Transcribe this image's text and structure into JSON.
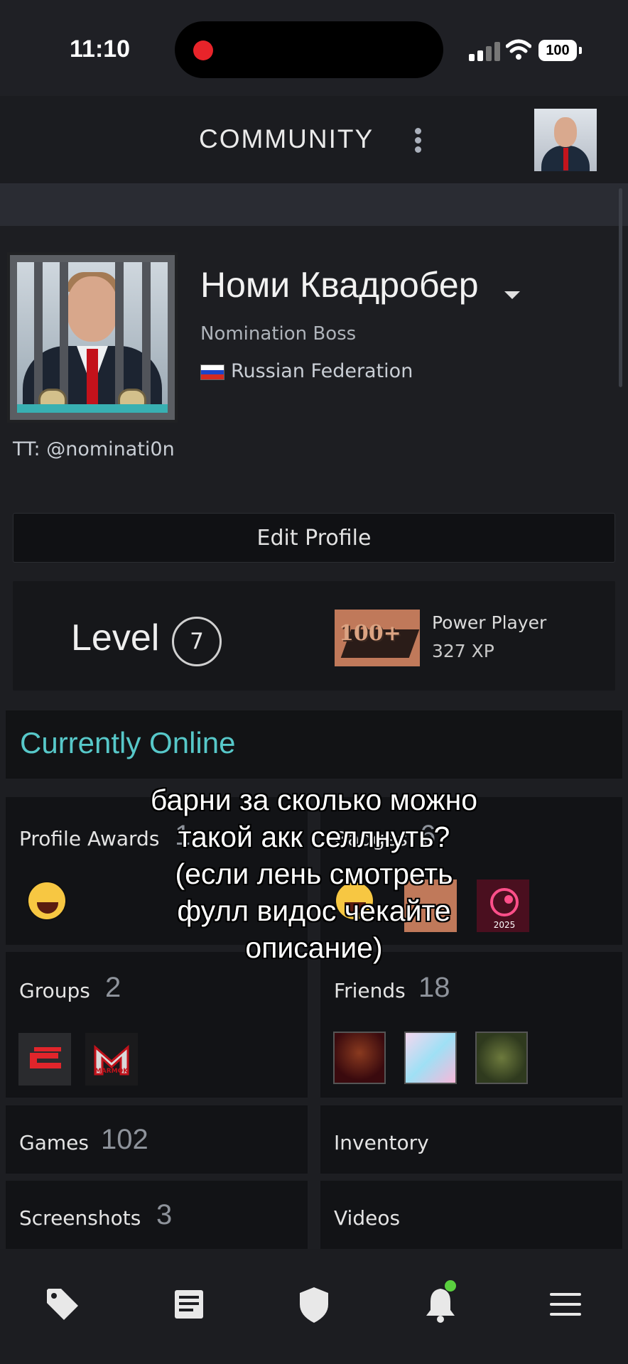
{
  "status_bar": {
    "time": "11:10",
    "battery": "100"
  },
  "header": {
    "title": "COMMUNITY"
  },
  "profile": {
    "name": "Номи Квадробер",
    "subtitle": "Nomination Boss",
    "country": "Russian Federation",
    "summary": "TT: @nominati0n",
    "edit_label": "Edit Profile"
  },
  "level": {
    "label": "Level",
    "value": "7",
    "badge_text": "100+",
    "badge_name": "Power Player",
    "badge_xp": "327 XP"
  },
  "status": {
    "online": "Currently Online"
  },
  "tiles": {
    "profile_awards": {
      "label": "Profile Awards",
      "count": "1"
    },
    "badges": {
      "label": "Badges",
      "count": "6",
      "steam_badge_year": "2025"
    },
    "groups": {
      "label": "Groups",
      "count": "2",
      "group_logo_text": "MARMOK"
    },
    "friends": {
      "label": "Friends",
      "count": "18"
    },
    "games": {
      "label": "Games",
      "count": "102"
    },
    "inventory": {
      "label": "Inventory"
    },
    "screenshots": {
      "label": "Screenshots",
      "count": "3"
    },
    "videos": {
      "label": "Videos"
    }
  },
  "overlay_caption": {
    "line1": "барни за сколько можно",
    "line2": "такой акк селлнуть?",
    "line3": "(если лень смотреть",
    "line4": "фулл видос чекайте",
    "line5": "описание)"
  },
  "bottom_nav": {
    "icons": [
      "tag-icon",
      "news-icon",
      "shield-icon",
      "bell-icon",
      "menu-icon"
    ],
    "notification_color": "#5ad03f"
  },
  "colors": {
    "accent_online": "#57c8c9",
    "background": "#1b1c20"
  }
}
